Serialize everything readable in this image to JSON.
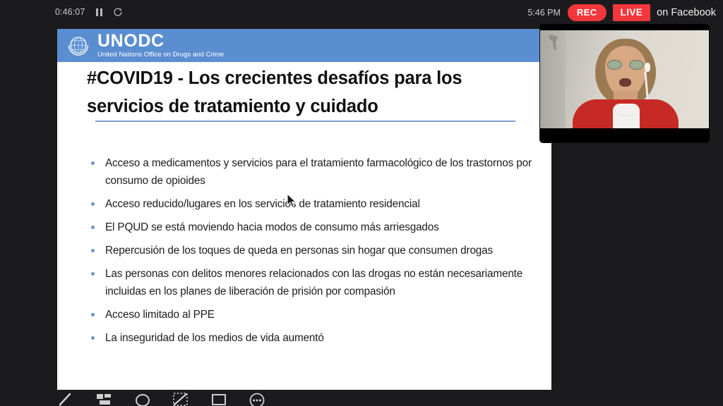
{
  "topbar": {
    "timer": "0:46:07",
    "pause_icon": "pause-icon",
    "restart_icon": "restart-icon",
    "clock": "5:46 PM",
    "rec_label": "REC",
    "live_label": "LIVE",
    "platform_label": "on Facebook",
    "accent_red": "#f4373c"
  },
  "slide": {
    "brand": {
      "emblem": "un-emblem-icon",
      "name": "UNODC",
      "subtitle": "United Nations Office on Drugs and Crime",
      "band_color": "#5b8ed1"
    },
    "title": "#COVID19 - Los crecientes desafíos para los servicios de tratamiento y cuidado",
    "bullets": [
      "Acceso a medicamentos y servicios para el tratamiento farmacológico de los trastornos por consumo de opioides",
      "Acceso reducido/lugares en los servicios de tratamiento residencial",
      "El PQUD se está moviendo hacia modos de consumo más arriesgados",
      "Repercusión de los toques de queda en personas sin hogar que consumen drogas",
      "Las personas con delitos menores relacionados con las drogas no están necesariamente incluidas en los planes de liberación de prisión por compasión",
      "Acceso limitado al PPE",
      "La inseguridad de los medios de vida aumentó"
    ],
    "bullet_color": "#6f94c8"
  },
  "webcam": {
    "label": "presenter-webcam"
  },
  "toolbar": {
    "tools": [
      "pen-icon",
      "shapes-icon",
      "ellipse-icon",
      "crop-line-icon",
      "rectangle-icon",
      "more-options-icon"
    ]
  },
  "cursor": {
    "type": "arrow-pointer"
  }
}
